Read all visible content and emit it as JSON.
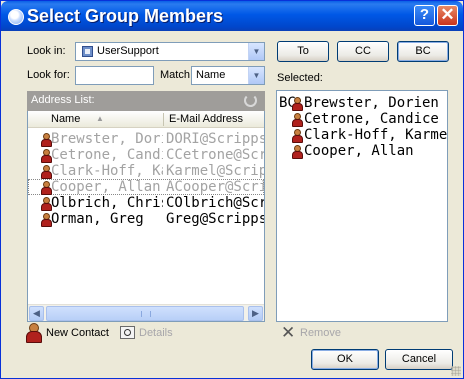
{
  "window": {
    "title": "Select Group Members"
  },
  "titlebar": {
    "help_label": "?",
    "close_label": "✕"
  },
  "look_in": {
    "label": "Look in:",
    "value": "UserSupport"
  },
  "look_for": {
    "label": "Look for:",
    "value": ""
  },
  "match": {
    "label": "Match",
    "value": "Name"
  },
  "recipient_buttons": {
    "to": "To",
    "cc": "CC",
    "bc": "BC"
  },
  "selected_label": "Selected:",
  "address_list": {
    "label": "Address List:",
    "columns": [
      "Name",
      "E-Mail Address"
    ],
    "rows": [
      {
        "name": "Brewster, Dorien",
        "email": "DORI@Scripps",
        "state": "added"
      },
      {
        "name": "Cetrone, Candice",
        "email": "CCetrone@Scripps",
        "state": "added"
      },
      {
        "name": "Clark-Hoff, Karmel",
        "email": "Karmel@Scripps",
        "state": "added"
      },
      {
        "name": "Cooper, Allan",
        "email": "ACooper@Scripps",
        "state": "added-focused"
      },
      {
        "name": "Olbrich, Chris",
        "email": "COlbrich@Scripps",
        "state": "normal"
      },
      {
        "name": "Orman, Greg",
        "email": "Greg@Scripps",
        "state": "normal"
      }
    ]
  },
  "selected": {
    "prefix": "BC:",
    "items": [
      "Brewster, Dorien",
      "Cetrone, Candice",
      "Clark-Hoff, Karmel",
      "Cooper, Allan"
    ]
  },
  "actions": {
    "new_contact": "New Contact",
    "details": "Details",
    "remove": "Remove",
    "ok": "OK",
    "cancel": "Cancel"
  },
  "colors": {
    "titlebar": "#0058e6",
    "face": "#ece9d8",
    "disabled_text": "#a3a3a3"
  }
}
